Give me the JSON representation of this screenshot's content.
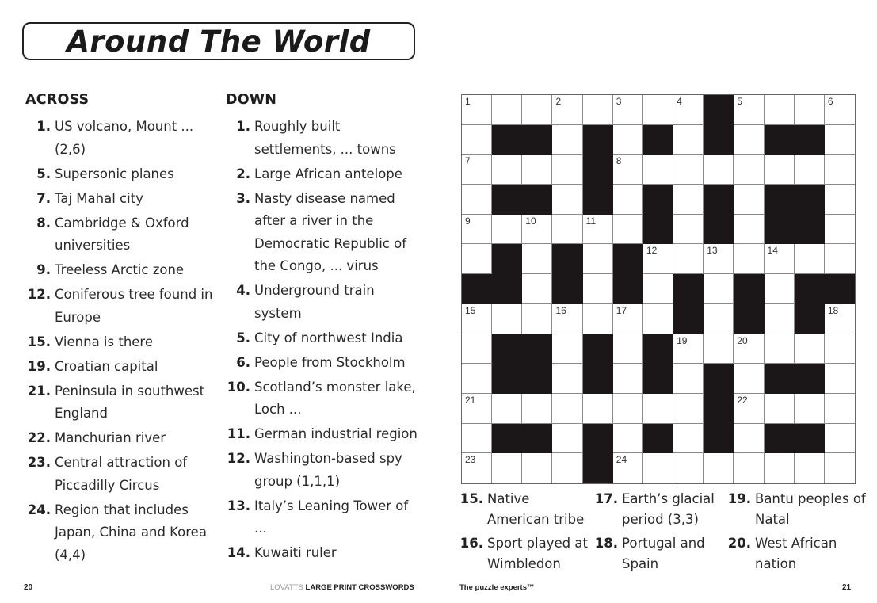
{
  "title": "Around The World",
  "across": {
    "heading": "ACROSS",
    "clues": [
      {
        "num": "1.",
        "text": "US volcano, Mount ... (2,6)"
      },
      {
        "num": "5.",
        "text": "Supersonic planes"
      },
      {
        "num": "7.",
        "text": "Taj Mahal city"
      },
      {
        "num": "8.",
        "text": "Cambridge & Oxford universities"
      },
      {
        "num": "9.",
        "text": "Treeless Arctic zone"
      },
      {
        "num": "12.",
        "text": "Coniferous tree found in Europe"
      },
      {
        "num": "15.",
        "text": "Vienna is there"
      },
      {
        "num": "19.",
        "text": "Croatian capital"
      },
      {
        "num": "21.",
        "text": "Peninsula in southwest England"
      },
      {
        "num": "22.",
        "text": "Manchurian river"
      },
      {
        "num": "23.",
        "text": "Central attraction of Piccadilly Circus"
      },
      {
        "num": "24.",
        "text": "Region that includes Japan, China and Korea (4,4)"
      }
    ]
  },
  "down": {
    "heading": "DOWN",
    "clues": [
      {
        "num": "1.",
        "text": "Roughly built settlements, ... towns"
      },
      {
        "num": "2.",
        "text": "Large African antelope"
      },
      {
        "num": "3.",
        "text": "Nasty disease named after a river in the Democratic Republic of the Congo, ... virus"
      },
      {
        "num": "4.",
        "text": "Underground train system"
      },
      {
        "num": "5.",
        "text": "City of northwest India"
      },
      {
        "num": "6.",
        "text": "People from Stockholm"
      },
      {
        "num": "10.",
        "text": "Scotland’s monster lake, Loch ..."
      },
      {
        "num": "11.",
        "text": "German industrial region"
      },
      {
        "num": "12.",
        "text": "Washington-based spy group (1,1,1)"
      },
      {
        "num": "13.",
        "text": "Italy’s Leaning Tower of ..."
      },
      {
        "num": "14.",
        "text": "Kuwaiti ruler"
      }
    ],
    "continued": [
      [
        {
          "num": "15.",
          "text": "Native American tribe"
        },
        {
          "num": "16.",
          "text": "Sport played at Wimbledon"
        }
      ],
      [
        {
          "num": "17.",
          "text": "Earth’s glacial period (3,3)"
        },
        {
          "num": "18.",
          "text": "Portugal and Spain"
        }
      ],
      [
        {
          "num": "19.",
          "text": "Bantu peoples of Natal"
        },
        {
          "num": "20.",
          "text": "West African nation"
        }
      ]
    ]
  },
  "grid": {
    "rows": 13,
    "cols": 13,
    "pattern": [
      "........#....",
      ".##.#.#.#.##.",
      "....#........",
      ".##.#.#.#.##.",
      "......#.#.##.",
      ".#.#.#.......",
      "##.#.#.#.#.##",
      ".......#.#.#.",
      ".##.#.#......",
      ".##.#.#.#.##.",
      "........#....",
      ".##.#.#.#.##.",
      "....#........"
    ],
    "numbers": [
      {
        "r": 0,
        "c": 0,
        "n": "1"
      },
      {
        "r": 0,
        "c": 3,
        "n": "2"
      },
      {
        "r": 0,
        "c": 5,
        "n": "3"
      },
      {
        "r": 0,
        "c": 7,
        "n": "4"
      },
      {
        "r": 0,
        "c": 9,
        "n": "5"
      },
      {
        "r": 0,
        "c": 12,
        "n": "6"
      },
      {
        "r": 2,
        "c": 0,
        "n": "7"
      },
      {
        "r": 2,
        "c": 5,
        "n": "8"
      },
      {
        "r": 4,
        "c": 0,
        "n": "9"
      },
      {
        "r": 4,
        "c": 2,
        "n": "10"
      },
      {
        "r": 4,
        "c": 4,
        "n": "11"
      },
      {
        "r": 5,
        "c": 6,
        "n": "12"
      },
      {
        "r": 5,
        "c": 8,
        "n": "13"
      },
      {
        "r": 5,
        "c": 10,
        "n": "14"
      },
      {
        "r": 7,
        "c": 0,
        "n": "15"
      },
      {
        "r": 7,
        "c": 3,
        "n": "16"
      },
      {
        "r": 7,
        "c": 5,
        "n": "17"
      },
      {
        "r": 7,
        "c": 12,
        "n": "18"
      },
      {
        "r": 8,
        "c": 7,
        "n": "19"
      },
      {
        "r": 8,
        "c": 9,
        "n": "20"
      },
      {
        "r": 10,
        "c": 0,
        "n": "21"
      },
      {
        "r": 10,
        "c": 9,
        "n": "22"
      },
      {
        "r": 12,
        "c": 0,
        "n": "23"
      },
      {
        "r": 12,
        "c": 5,
        "n": "24"
      }
    ]
  },
  "footer": {
    "left_page": "20",
    "brand_light": "LOVATTS",
    "brand_bold": "LARGE PRINT CROSSWORDS",
    "tagline": "The puzzle experts™",
    "right_page": "21"
  }
}
